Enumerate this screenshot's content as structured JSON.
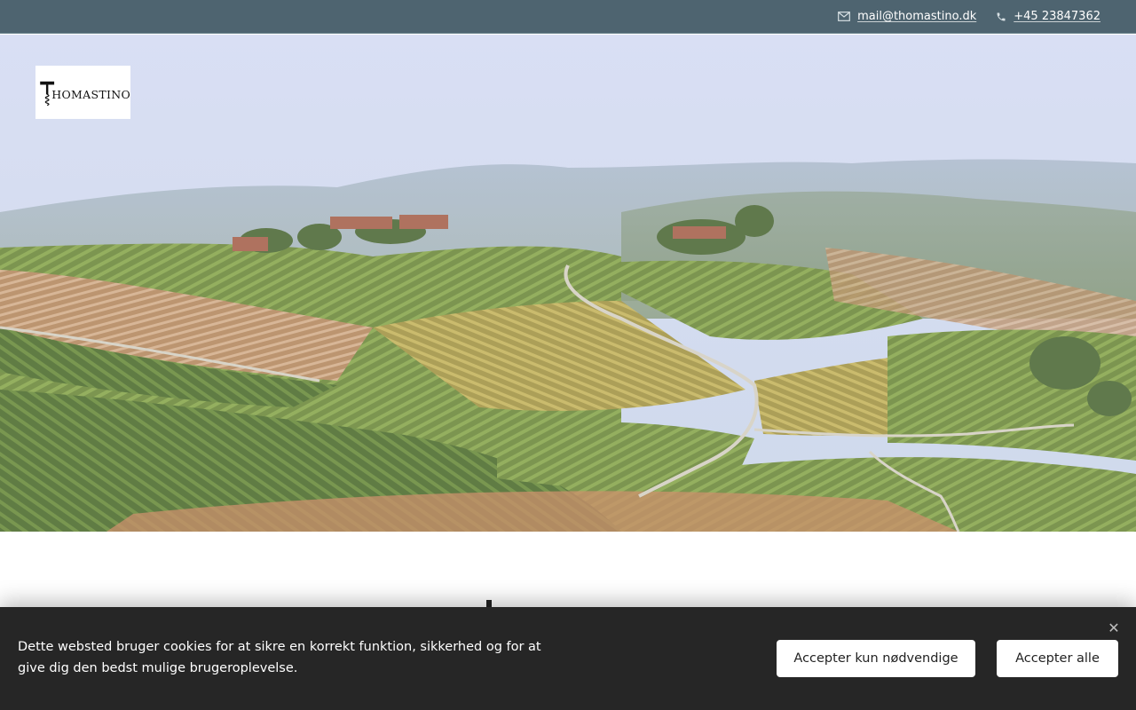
{
  "topbar": {
    "email": "mail@thomastino.dk",
    "phone": "+45 23847362",
    "email_icon": "mail-icon",
    "phone_icon": "phone-icon"
  },
  "header": {
    "logo_text": "HOMASTINO"
  },
  "cookie_banner": {
    "text": "Dette websted bruger cookies for at sikre en korrekt funktion, sikkerhed og for at give dig den bedst mulige brugeroplevelse.",
    "accept_necessary_label": "Accepter kun nødvendige",
    "accept_all_label": "Accepter alle",
    "close_icon": "close-icon"
  },
  "colors": {
    "topbar": "#4e6470",
    "cookie_banner": "#262626",
    "button_bg": "#ffffff"
  }
}
